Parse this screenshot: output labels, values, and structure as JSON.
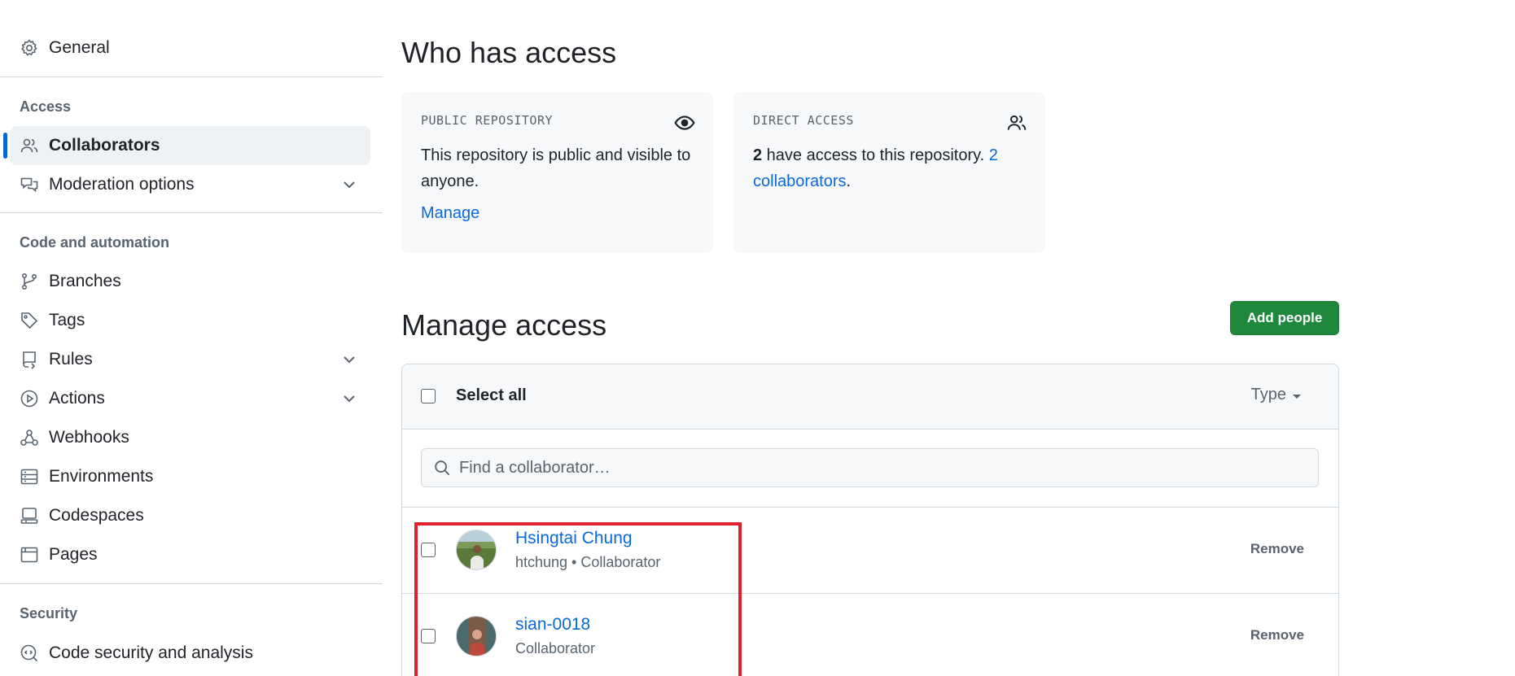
{
  "sidebar": {
    "general": "General",
    "groups": {
      "access": "Access",
      "code_automation": "Code and automation",
      "security": "Security"
    },
    "items": {
      "collaborators": "Collaborators",
      "moderation": "Moderation options",
      "branches": "Branches",
      "tags": "Tags",
      "rules": "Rules",
      "actions": "Actions",
      "webhooks": "Webhooks",
      "environments": "Environments",
      "codespaces": "Codespaces",
      "pages": "Pages",
      "code_security": "Code security and analysis"
    },
    "icons": {
      "general": "gear-icon",
      "collaborators": "people-icon",
      "moderation": "comment-discussion-icon",
      "branches": "git-branch-icon",
      "tags": "tag-icon",
      "rules": "repo-push-icon",
      "actions": "play-icon",
      "webhooks": "webhook-icon",
      "environments": "server-icon",
      "codespaces": "codespaces-icon",
      "pages": "browser-icon",
      "code_security": "codescan-icon"
    }
  },
  "main": {
    "who_has_access": {
      "title": "Who has access",
      "public_card": {
        "label": "PUBLIC REPOSITORY",
        "text": "This repository is public and visible to anyone.",
        "link": "Manage",
        "icon": "eye-icon"
      },
      "direct_card": {
        "label": "DIRECT ACCESS",
        "count": "2",
        "text": " have access to this repository. ",
        "link": "2 collaborators",
        "suffix": ".",
        "icon": "people-icon"
      }
    },
    "manage_access": {
      "title": "Manage access",
      "add_button": "Add people",
      "select_all": "Select all",
      "type_filter": "Type",
      "search_placeholder": "Find a collaborator…",
      "collaborators": [
        {
          "name": "Hsingtai Chung",
          "meta": "htchung • Collaborator",
          "action": "Remove"
        },
        {
          "name": "sian-0018",
          "meta": "Collaborator",
          "action": "Remove"
        }
      ]
    }
  },
  "colors": {
    "accent": "#0969da",
    "primary_button": "#1f883d",
    "highlight_box": "#e0202c",
    "muted_text": "#59636e"
  }
}
